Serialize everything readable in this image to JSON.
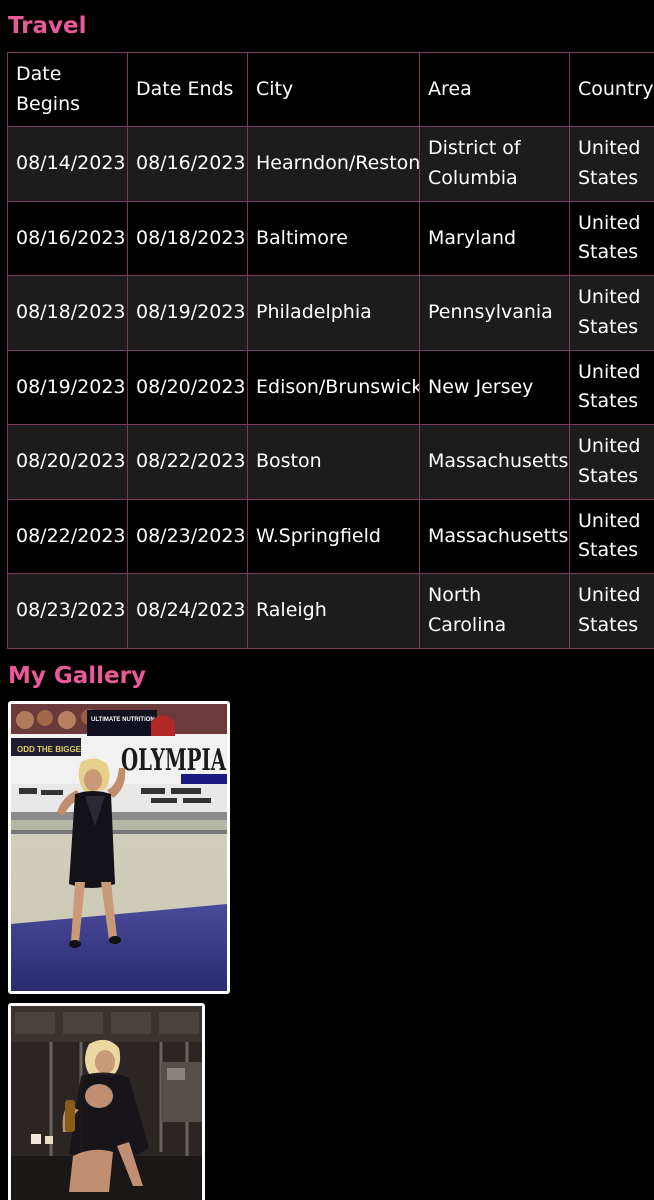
{
  "travel": {
    "title": "Travel",
    "columns": [
      "Date Begins",
      "Date Ends",
      "City",
      "Area",
      "Country"
    ],
    "rows": [
      [
        "08/14/2023",
        "08/16/2023",
        "Hearndon/Reston",
        "District of Columbia",
        "United States"
      ],
      [
        "08/16/2023",
        "08/18/2023",
        "Baltimore",
        "Maryland",
        "United States"
      ],
      [
        "08/18/2023",
        "08/19/2023",
        "Philadelphia",
        "Pennsylvania",
        "United States"
      ],
      [
        "08/19/2023",
        "08/20/2023",
        "Edison/Brunswick",
        "New Jersey",
        "United States"
      ],
      [
        "08/20/2023",
        "08/22/2023",
        "Boston",
        "Massachusetts",
        "United States"
      ],
      [
        "08/22/2023",
        "08/23/2023",
        "W.Springfield",
        "Massachusetts",
        "United States"
      ],
      [
        "08/23/2023",
        "08/24/2023",
        "Raleigh",
        "North Carolina",
        "United States"
      ]
    ]
  },
  "gallery": {
    "title": "My Gallery",
    "photos": [
      {
        "banner_brand": "ULTIMATE NUTRITION",
        "banner_text": "OLYMPIA"
      },
      {}
    ]
  },
  "colors": {
    "accent": "#ea5a9b",
    "table_border": "#7a3a5e",
    "row_alt": "#1c1c1c",
    "background": "#000000"
  }
}
